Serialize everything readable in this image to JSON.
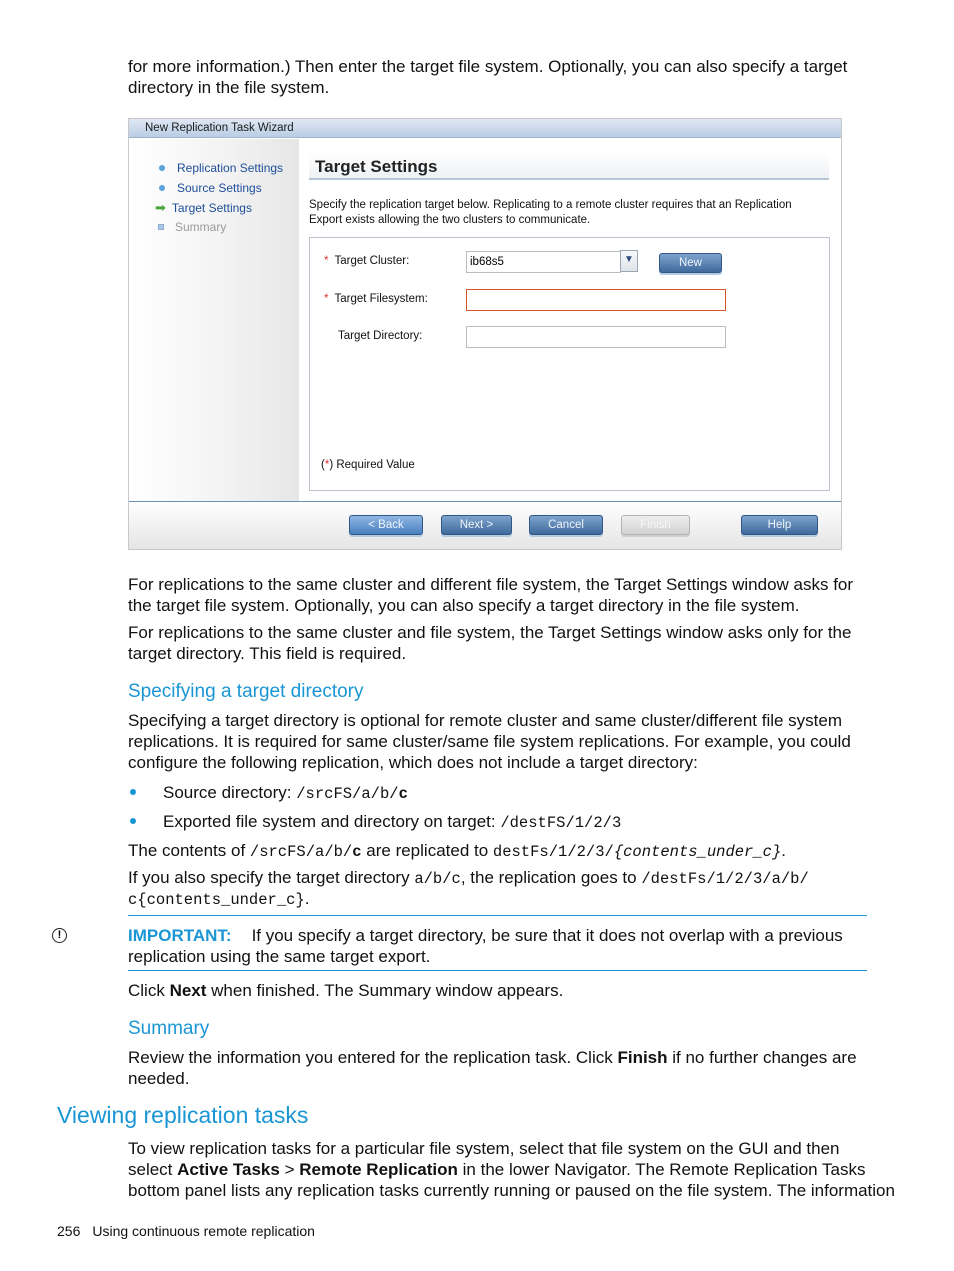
{
  "intro": {
    "line1": "for more information.) Then enter the target file system. Optionally, you can also specify a target",
    "line2": "directory in the file system."
  },
  "wizard": {
    "window_title": "New Replication Task Wizard",
    "nav": [
      {
        "label": "Replication Settings",
        "state": "completed"
      },
      {
        "label": "Source Settings",
        "state": "completed"
      },
      {
        "label": "Target Settings",
        "state": "current"
      },
      {
        "label": "Summary",
        "state": "disabled"
      }
    ],
    "title": "Target Settings",
    "description_line1": "Specify the replication target below. Replicating to a remote cluster requires that an Replication",
    "description_line2": "Export exists allowing the two clusters to communicate.",
    "fields": {
      "target_cluster": {
        "label": "Target Cluster:",
        "value": "ib68s5",
        "required_marker": "*"
      },
      "target_filesystem": {
        "label": "Target Filesystem:",
        "value": "",
        "required_marker": "*"
      },
      "target_directory": {
        "label": "Target Directory:",
        "value": ""
      }
    },
    "new_button": "New",
    "required_note_open": "(",
    "required_note_star": "*",
    "required_note_rest": ") Required Value",
    "buttons": {
      "back": "< Back",
      "next": "Next >",
      "cancel": "Cancel",
      "finish": "Finish",
      "help": "Help"
    }
  },
  "paragraphs": {
    "p1_line1": "For replications to the same cluster and different file system, the Target Settings window asks for",
    "p1_line2": "the target file system. Optionally, you can also specify a target directory in the file system.",
    "p2_line1": "For replications to the same cluster and file system, the Target Settings window asks only for the",
    "p2_line2": "target directory. This field is required."
  },
  "section_specifying": {
    "heading": "Specifying a target directory",
    "line1": "Specifying a target directory is optional for remote cluster and same cluster/different file system",
    "line2": "replications. It is required for same cluster/same file system replications. For example, you could",
    "line3": "configure the following replication, which does not include a target directory:",
    "bullets": [
      {
        "text": "Source directory: ",
        "code": "/srcFS/a/b/",
        "code_bold": "c"
      },
      {
        "text": "Exported file system and directory on target: ",
        "code": "/destFS/1/2/3"
      }
    ],
    "contents_line": {
      "t1": "The contents of ",
      "c1": "/srcFS/a/b/",
      "c1b": "c",
      "t2": " are replicated to ",
      "c2": "destFs/1/2/3/",
      "c3": "{contents_under_c}",
      "t3": "."
    },
    "target_line": {
      "t1": "If you also specify the target directory ",
      "c1": "a/b/c",
      "t2": ", the replication goes to ",
      "c2": "/destFs/1/2/3/a/b/",
      "c3": "c{contents_under_c}",
      "t3": "."
    },
    "important": {
      "label": "IMPORTANT:",
      "line1": "If you specify a target directory, be sure that it does not overlap with a previous",
      "line2": "replication using the same target export."
    },
    "next_line": {
      "t1": "Click ",
      "b": "Next",
      "t2": " when finished. The Summary window appears."
    }
  },
  "section_summary": {
    "heading": "Summary",
    "line1_a": "Review the information you entered for the replication task. Click ",
    "line1_b": "Finish",
    "line1_c": " if no further changes are",
    "line2": "needed."
  },
  "section_viewing": {
    "heading": "Viewing replication tasks",
    "line1": "To view replication tasks for a particular file system, select that file system on the GUI and then",
    "line2_a": "select ",
    "line2_b": "Active Tasks",
    "line2_c": " > ",
    "line2_d": "Remote Replication",
    "line2_e": " in the lower Navigator. The Remote Replication Tasks",
    "line3": "bottom panel lists any replication tasks currently running or paused on the file system. The information"
  },
  "footer": {
    "page_number": "256",
    "chapter": "Using continuous remote replication"
  },
  "colors": {
    "heading_blue": "#1a96d4",
    "required_red": "#e23030",
    "error_border": "#d9532f"
  }
}
